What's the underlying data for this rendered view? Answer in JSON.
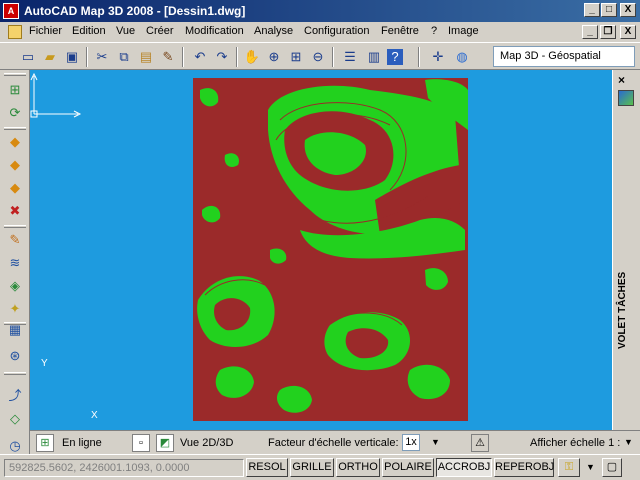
{
  "window": {
    "title": "AutoCAD Map 3D 2008 - [Dessin1.dwg]",
    "app_icon_text": "A",
    "min_label": "_",
    "max_label": "□",
    "close_label": "X"
  },
  "menu": {
    "items": [
      "Fichier",
      "Edition",
      "Vue",
      "Créer",
      "Modification",
      "Analyse",
      "Configuration",
      "Fenêtre",
      "?",
      "Image"
    ],
    "mdi_min": "_",
    "mdi_restore": "❐",
    "mdi_close": "X"
  },
  "toolbar": {
    "workspace": "Map 3D - Géospatial"
  },
  "taskpane": {
    "label": "VOLET TÂCHES",
    "close": "×"
  },
  "ucs": {
    "x": "X",
    "y": "Y"
  },
  "status_top": {
    "online": "En ligne",
    "view_mode": "Vue 2D/3D",
    "vertical_factor_label": "Facteur d'échelle verticale:",
    "vertical_factor_value": "1x",
    "show_scale": "Afficher échelle 1 :"
  },
  "status_bottom": {
    "coordinates": "592825.5602, 2426001.1093, 0.0000",
    "toggles": [
      {
        "label": "RESOL",
        "on": false
      },
      {
        "label": "GRILLE",
        "on": false
      },
      {
        "label": "ORTHO",
        "on": false
      },
      {
        "label": "POLAIRE",
        "on": false
      },
      {
        "label": "ACCROBJ",
        "on": true
      },
      {
        "label": "REPEROBJ",
        "on": false
      }
    ]
  },
  "colors": {
    "background": "#1e9bdf",
    "terrain_low": "#9b2a2a",
    "terrain_high": "#22d11e",
    "title_bar": "#0a246a"
  }
}
